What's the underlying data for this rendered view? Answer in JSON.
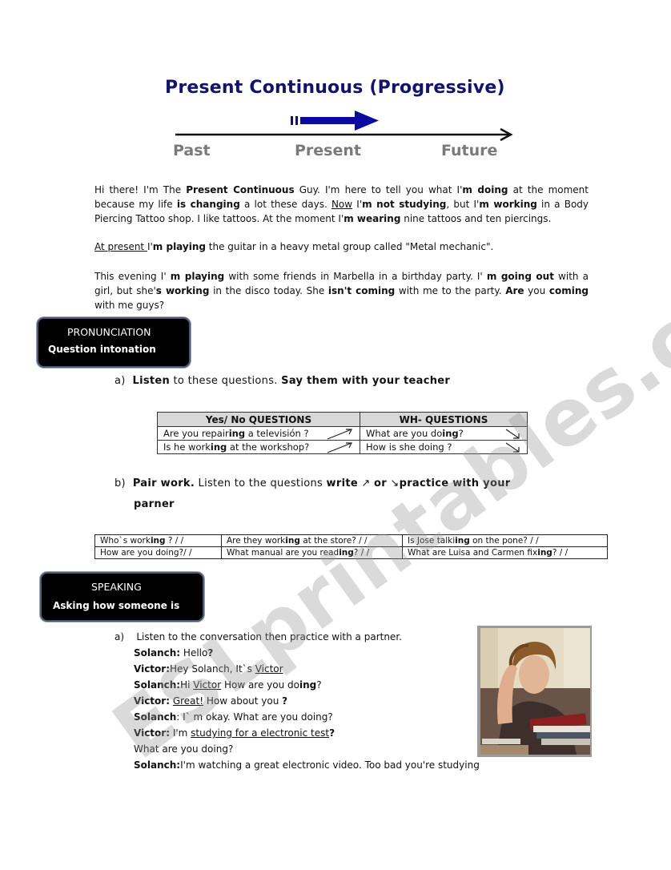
{
  "header": {
    "title": "Present Continuous (Progressive)",
    "timeline_labels": [
      "Past",
      "Present",
      "Future"
    ],
    "colors": {
      "title": "#13136b",
      "arrow": "#0a0aa0",
      "labels": "#7a7a7a"
    }
  },
  "intro": {
    "p1": [
      {
        "t": "Hi there! I'm The ",
        "s": ""
      },
      {
        "t": "Present Continuous",
        "s": "b"
      },
      {
        "t": " Guy. I'm here to tell you what I'",
        "s": ""
      },
      {
        "t": "m doing",
        "s": "b"
      },
      {
        "t": " at the moment because my life ",
        "s": ""
      },
      {
        "t": "is changing",
        "s": "b"
      },
      {
        "t": " a lot these days. ",
        "s": ""
      },
      {
        "t": "Now",
        "s": "u"
      },
      {
        "t": " I'",
        "s": ""
      },
      {
        "t": "m not studying",
        "s": "b"
      },
      {
        "t": ", but I'",
        "s": ""
      },
      {
        "t": "m working",
        "s": "b"
      },
      {
        "t": " in a Body Piercing Tattoo shop. I like tattoos. At the moment I'",
        "s": ""
      },
      {
        "t": "m wearing",
        "s": "b"
      },
      {
        "t": " nine tattoos and ten piercings.",
        "s": ""
      }
    ],
    "p2": [
      {
        "t": "At present ",
        "s": "u"
      },
      {
        "t": "I'",
        "s": ""
      },
      {
        "t": "m playing",
        "s": "b"
      },
      {
        "t": " the guitar in a heavy metal group called \"Metal mechanic\".",
        "s": ""
      }
    ],
    "p3": [
      {
        "t": "This evening I' ",
        "s": ""
      },
      {
        "t": "m playing",
        "s": "b"
      },
      {
        "t": " with some friends in Marbella in a birthday party. I' ",
        "s": ""
      },
      {
        "t": "m going out",
        "s": "b"
      },
      {
        "t": " with a girl, but she'",
        "s": ""
      },
      {
        "t": "s working",
        "s": "b"
      },
      {
        "t": " in the disco today. She ",
        "s": ""
      },
      {
        "t": "isn't coming",
        "s": "b"
      },
      {
        "t": " with me to the party. ",
        "s": ""
      },
      {
        "t": "Are",
        "s": "b"
      },
      {
        "t": " you ",
        "s": ""
      },
      {
        "t": "coming",
        "s": "b"
      },
      {
        "t": " with me guys?",
        "s": ""
      }
    ]
  },
  "pronunciation": {
    "banner_title": "PRONUNCIATION",
    "banner_subtitle": "Question intonation",
    "exercise_a": {
      "marker": "a)",
      "parts": [
        {
          "t": "Listen",
          "s": "b"
        },
        {
          "t": "  to these questions. ",
          "s": ""
        },
        {
          "t": "Say them with  your teacher",
          "s": "b"
        }
      ]
    },
    "table": {
      "headers": [
        "Yes/ No QUESTIONS",
        "WH- QUESTIONS"
      ],
      "rows": [
        {
          "yesno": [
            {
              "t": "Are you repair",
              "s": ""
            },
            {
              "t": "ing",
              "s": "b"
            },
            {
              "t": " a televisión ?",
              "s": ""
            }
          ],
          "yesno_intonation": "rising",
          "wh": [
            {
              "t": "What are you do",
              "s": ""
            },
            {
              "t": "ing",
              "s": "b"
            },
            {
              "t": "?",
              "s": ""
            }
          ],
          "wh_intonation": "falling"
        },
        {
          "yesno": [
            {
              "t": "Is he work",
              "s": ""
            },
            {
              "t": "ing",
              "s": "b"
            },
            {
              "t": " at the workshop?",
              "s": ""
            }
          ],
          "yesno_intonation": "rising",
          "wh": [
            {
              "t": "How is she doing ?",
              "s": ""
            }
          ],
          "wh_intonation": "falling"
        }
      ]
    },
    "exercise_b": {
      "marker": "b)",
      "parts": [
        {
          "t": "Pair  work.",
          "s": "b"
        },
        {
          "t": " Listen  to the questions ",
          "s": ""
        },
        {
          "t": "write",
          "s": "b"
        },
        {
          "t": "  ↗ ",
          "s": ""
        },
        {
          "t": "or",
          "s": "b"
        },
        {
          "t": "  ↘",
          "s": ""
        },
        {
          "t": "practice with your",
          "s": "b"
        }
      ],
      "continuation": "parner"
    },
    "pair_table": [
      [
        [
          {
            "t": "Who`s work",
            "s": ""
          },
          {
            "t": "ing",
            "s": "b"
          },
          {
            "t": " ?    /    /",
            "s": ""
          }
        ],
        [
          {
            "t": "Are they work",
            "s": ""
          },
          {
            "t": "ing",
            "s": "b"
          },
          {
            "t": "  at the store? /    /",
            "s": ""
          }
        ],
        [
          {
            "t": "Is Jose talki",
            "s": ""
          },
          {
            "t": "ing",
            "s": "b"
          },
          {
            "t": " on the pone?              /    /",
            "s": ""
          }
        ]
      ],
      [
        [
          {
            "t": "How are you doing?/    /",
            "s": ""
          }
        ],
        [
          {
            "t": "What manual are you read",
            "s": ""
          },
          {
            "t": "ing",
            "s": "b"
          },
          {
            "t": "? /    /",
            "s": ""
          }
        ],
        [
          {
            "t": "What  are Luisa and Carmen fix",
            "s": ""
          },
          {
            "t": "ing",
            "s": "b"
          },
          {
            "t": "? /    /",
            "s": ""
          }
        ]
      ]
    ]
  },
  "speaking": {
    "banner_title": "SPEAKING",
    "banner_subtitle": "Asking how someone is",
    "exercise_a": {
      "marker": "a)",
      "text": "Listen  to the conversation then practice with a partner."
    },
    "conversation": [
      {
        "speaker": "Solanch:",
        "parts": [
          {
            "t": "  Hello",
            "s": ""
          },
          {
            "t": "?",
            "s": "b"
          }
        ]
      },
      {
        "speaker": "Victor:",
        "parts": [
          {
            "t": "Hey Solanch, It`s  ",
            "s": ""
          },
          {
            "t": "Victor",
            "s": "u"
          }
        ]
      },
      {
        "speaker": "Solanch:",
        "parts": [
          {
            "t": "Hi ",
            "s": ""
          },
          {
            "t": "Victor",
            "s": "u"
          },
          {
            "t": " How are  you do",
            "s": ""
          },
          {
            "t": "ing",
            "s": "b"
          },
          {
            "t": "?",
            "s": ""
          }
        ]
      },
      {
        "speaker": "Victor:",
        "parts": [
          {
            "t": "   ",
            "s": ""
          },
          {
            "t": "Great!",
            "s": "u"
          },
          {
            "t": " How about you ",
            "s": ""
          },
          {
            "t": "?",
            "s": "b"
          }
        ]
      },
      {
        "speaker": "Solanch",
        "parts": [
          {
            "t": ": I` m okay. What are you doing?",
            "s": ""
          }
        ]
      },
      {
        "speaker": "Victor:",
        "parts": [
          {
            "t": "  I'm ",
            "s": ""
          },
          {
            "t": "studying for a electronic test",
            "s": "u"
          },
          {
            "t": "?",
            "s": "b"
          }
        ]
      },
      {
        "speaker": "",
        "parts": [
          {
            "t": "           What are you doing?",
            "s": ""
          }
        ]
      },
      {
        "speaker": "Solanch:",
        "parts": [
          {
            "t": "I'm watching a great electronic video. Too bad you're studying",
            "s": ""
          }
        ]
      }
    ],
    "photo_alt": "student-with-books-photo"
  },
  "watermark": "ESLprintables.com"
}
